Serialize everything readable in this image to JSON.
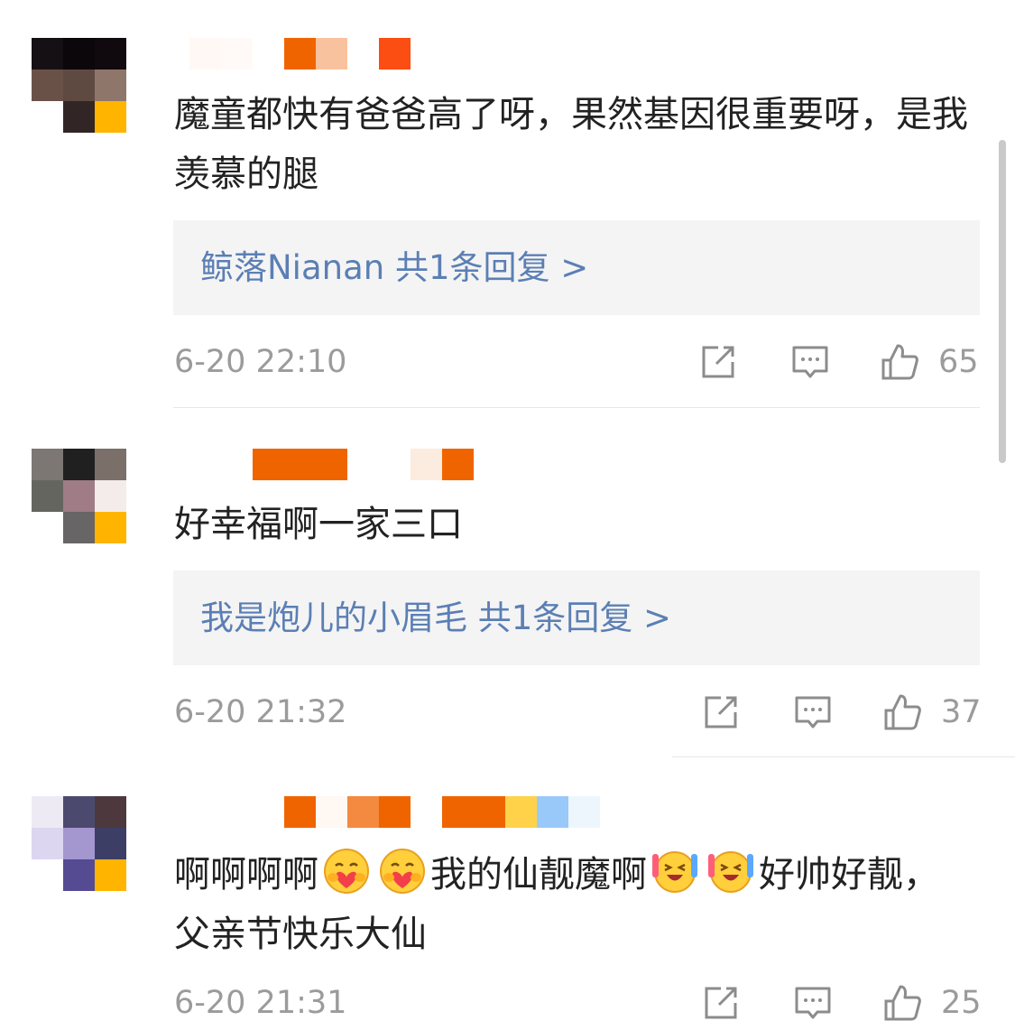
{
  "comments": [
    {
      "text": "魔童都快有爸爸高了呀，果然基因很重要呀，是我羡慕的腿",
      "reply": "鲸落Nianan  共1条回复 >",
      "time": "6-20 22:10",
      "likes": "65"
    },
    {
      "text": "好幸福啊一家三口",
      "reply": "我是炮儿的小眉毛  共1条回复 >",
      "time": "6-20 21:32",
      "likes": "37"
    },
    {
      "text_parts": [
        "啊啊啊啊",
        "我的仙靓魔啊",
        "好帅好靓，父亲节快乐大仙"
      ],
      "emojis": [
        "hug-heart-emoji",
        "hug-heart-emoji",
        "laugh-cheer-emoji",
        "laugh-cheer-emoji"
      ],
      "time": "6-20 21:31",
      "likes": "25"
    }
  ],
  "icons": {
    "share": "share-icon",
    "comment": "comment-icon",
    "like": "thumbs-up-icon"
  },
  "colors": {
    "link": "#5b7fb4",
    "meta": "#9b9b9b",
    "reply_bg": "#f4f4f4",
    "badge_orange": "#f06400",
    "badge_yellow": "#ffb400"
  }
}
